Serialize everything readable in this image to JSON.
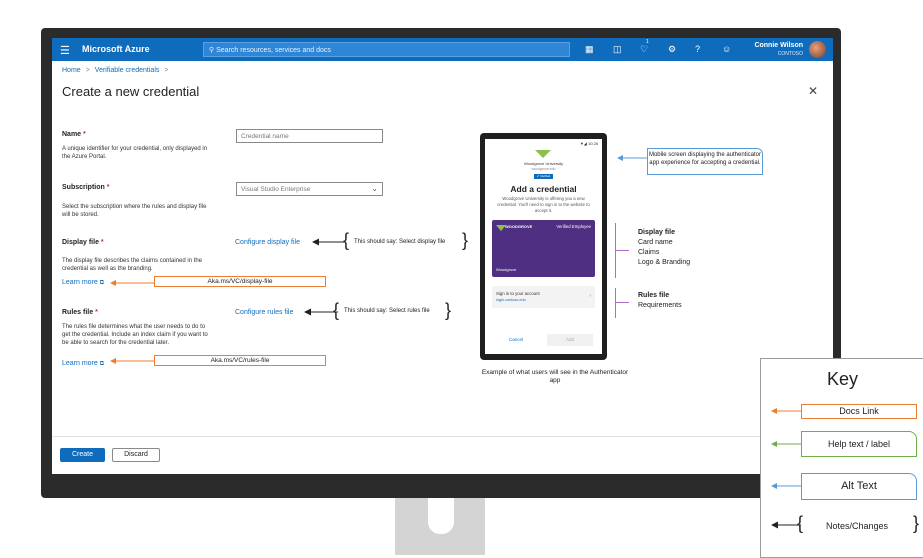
{
  "topbar": {
    "brand": "Microsoft Azure",
    "search_placeholder": "Search resources, services and docs",
    "user_name": "Connie Wilson",
    "user_org": "CONTOSO",
    "notification_count": "1"
  },
  "breadcrumb": {
    "home": "Home",
    "section": "Verifiable credentials"
  },
  "page_title": "Create a new credential",
  "form": {
    "name": {
      "label": "Name",
      "required_mark": "*",
      "description": "A unique identifier for your credential, only displayed in the Azure Portal.",
      "placeholder": "Credential name"
    },
    "subscription": {
      "label": "Subscription",
      "required_mark": "*",
      "description": "Select the subscription where the rules and display file will be stored.",
      "value": "Visual Studio Enterprise"
    },
    "display_file": {
      "label": "Display file",
      "required_mark": "*",
      "description": "The display file describes the claims contained in the credential as well as the branding.",
      "learn_more": "Learn more",
      "action_link": "Configure display file",
      "doc_link": "Aka.ms/VC/display-file",
      "note": "This should say: Select display file"
    },
    "rules_file": {
      "label": "Rules file",
      "required_mark": "*",
      "description": "The rules file determines what the user needs to do to get the credential.  Include an index claim if you want to be able to search for the credential later.",
      "learn_more": "Learn more",
      "action_link": "Configure rules file",
      "doc_link": "Aka.ms/VC/rules-file",
      "note": "This should say: Select rules file"
    }
  },
  "buttons": {
    "create": "Create",
    "discard": "Discard"
  },
  "phone": {
    "status": "10:28",
    "org": "Woodgrove University",
    "org_domain": "woodgrove.edu",
    "verified_badge": "✔ Verified",
    "title": "Add a credential",
    "text": "Woodgrove University is offering you a new credential. You'll need to sign in to the website to accept it.",
    "card_logo": "WOODGROVE",
    "card_type": "Verified Employee",
    "card_org": "Woodgrove",
    "signin_title": "Sign in to your account",
    "signin_url": "login.contoso.edu",
    "cancel": "Cancel",
    "add": "Add"
  },
  "phone_caption": "Example of what users will see in the Authenticator app",
  "alt_text": "Mobile screen displaying the authenticator app experience for accepting a credential.",
  "side_labels": {
    "display_head": "Display file",
    "display_items": [
      "Card name",
      "Claims",
      "Logo & Branding"
    ],
    "rules_head": "Rules file",
    "rules_items": [
      "Requirements"
    ]
  },
  "key": {
    "title": "Key",
    "docs_link": "Docs Link",
    "help_text": "Help text / label",
    "alt_text": "Alt Text",
    "notes": "Notes/Changes"
  },
  "colors": {
    "azure_blue": "#0f6cbd",
    "docs_orange": "#ed7d31",
    "help_green": "#70ad47",
    "alt_blue": "#5b9bd5",
    "card_purple": "#4e2f82"
  }
}
